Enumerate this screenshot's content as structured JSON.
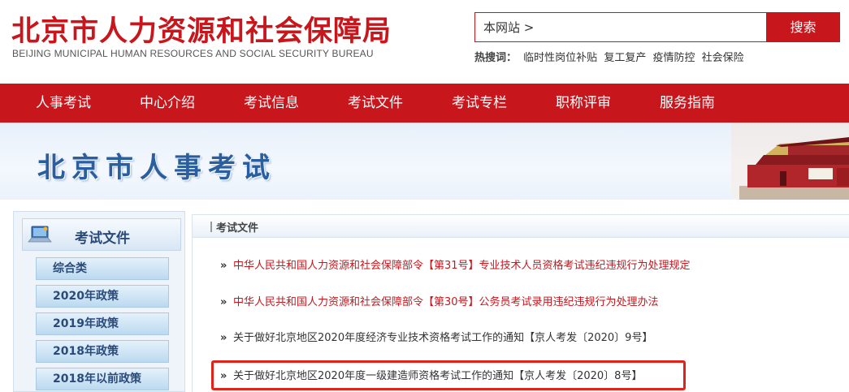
{
  "header": {
    "logo_cn": "北京市人力资源和社会保障局",
    "logo_en": "BEIJING MUNICIPAL HUMAN RESOURCES AND SOCIAL SECURITY BUREAU",
    "search_value": "本网站 >",
    "search_button": "搜索",
    "hot_label": "热搜词：",
    "hot_keywords": [
      "临时性岗位补贴",
      "复工复产",
      "疫情防控",
      "社会保险"
    ]
  },
  "nav": {
    "items": [
      "人事考试",
      "中心介绍",
      "考试信息",
      "考试文件",
      "考试专栏",
      "职称评审",
      "服务指南"
    ]
  },
  "banner": {
    "title": "北京市人事考试"
  },
  "sidebar": {
    "title": "考试文件",
    "items": [
      "综合类",
      "2020年政策",
      "2019年政策",
      "2018年政策",
      "2018年以前政策"
    ]
  },
  "main": {
    "section_title": "考试文件",
    "items": [
      {
        "text": "中华人民共和国人力资源和社会保障部令【第31号】专业技术人员资格考试违纪违规行为处理规定",
        "color": "#c8161d"
      },
      {
        "text": "中华人民共和国人力资源和社会保障部令【第30号】公务员考试录用违纪违规行为处理办法",
        "color": "#c8161d"
      },
      {
        "text": "关于做好北京地区2020年度经济专业技术资格考试工作的通知【京人考发〔2020〕9号】",
        "color": "#333333"
      },
      {
        "text": "关于做好北京地区2020年度一级建造师资格考试工作的通知【京人考发〔2020〕8号】",
        "color": "#333333"
      }
    ]
  },
  "colors": {
    "brand_red": "#c8161d",
    "banner_blue": "#2b5e9e",
    "highlight": "#e2231a"
  }
}
